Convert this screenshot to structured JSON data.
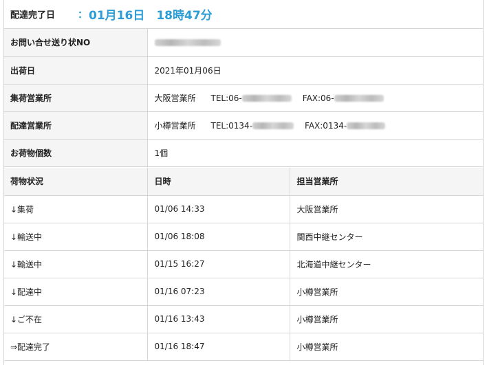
{
  "status": {
    "label": "配達完了日",
    "colon": "：",
    "date": "01月16日",
    "time": "18時47分"
  },
  "info": {
    "inquiry_label": "お問い合せ送り状NO",
    "ship_date_label": "出荷日",
    "ship_date": "2021年01月06日",
    "pickup_label": "集荷営業所",
    "pickup_office": "大阪営業所",
    "pickup_tel_prefix": "TEL:06-",
    "pickup_fax_prefix": "FAX:06-",
    "delivery_label": "配達営業所",
    "delivery_office": "小樽営業所",
    "delivery_tel_prefix": "TEL:0134-",
    "delivery_fax_prefix": "FAX:0134-",
    "count_label": "お荷物個数",
    "count": "1個"
  },
  "history": {
    "headers": [
      "荷物状況",
      "日時",
      "担当営業所"
    ],
    "rows": [
      {
        "status": "↓集荷",
        "datetime": "01/06 14:33",
        "office": "大阪営業所"
      },
      {
        "status": "↓輸送中",
        "datetime": "01/06 18:08",
        "office": "関西中継センター"
      },
      {
        "status": "↓輸送中",
        "datetime": "01/15 16:27",
        "office": "北海道中継センター"
      },
      {
        "status": "↓配達中",
        "datetime": "01/16 07:23",
        "office": "小樽営業所"
      },
      {
        "status": "↓ご不在",
        "datetime": "01/16 13:43",
        "office": "小樽営業所"
      },
      {
        "status": "⇒配達完了",
        "datetime": "01/16 18:47",
        "office": "小樽営業所"
      }
    ]
  },
  "colors": {
    "accent": "#2c9cd6",
    "label_bg": "#f5f5f5",
    "border": "#d6d6d6"
  }
}
